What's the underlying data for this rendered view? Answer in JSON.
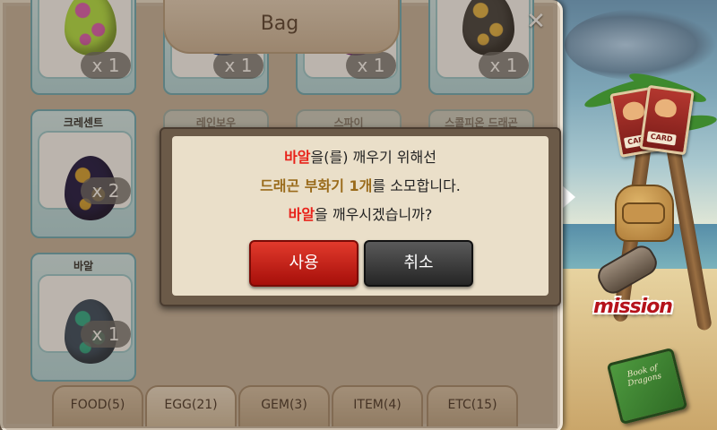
{
  "bag": {
    "title": "Bag",
    "close_label": "✕",
    "slots": [
      {
        "label": "",
        "count": "x 1",
        "egg_color": "#b6e84a",
        "spot_color": "#e062b8"
      },
      {
        "label": "",
        "count": "x 1",
        "egg_color": "#2257c6",
        "spot_color": "#6bb1ff"
      },
      {
        "label": "",
        "count": "x 1",
        "egg_color": "#a03ab8",
        "spot_color": "#e06fd9"
      },
      {
        "label": "",
        "count": "x 1",
        "egg_color": "#444444",
        "spot_color": "#e7b84a"
      },
      {
        "label": "크레센트",
        "count": "x 2",
        "egg_color": "#1e1a4a",
        "spot_color": "#d9a638"
      },
      {
        "label": "레인보우",
        "count": "",
        "egg_color": "#cccccc",
        "spot_color": "#aaaaaa"
      },
      {
        "label": "스파이",
        "count": "",
        "egg_color": "#cccccc",
        "spot_color": "#aaaaaa"
      },
      {
        "label": "스콜피온 드래곤",
        "count": "",
        "egg_color": "#cccccc",
        "spot_color": "#aaaaaa"
      },
      {
        "label": "바알",
        "count": "x 1",
        "egg_color": "#3a4f66",
        "spot_color": "#2fb08f"
      }
    ],
    "tabs": [
      {
        "label": "FOOD(5)",
        "active": false
      },
      {
        "label": "EGG(21)",
        "active": true
      },
      {
        "label": "GEM(3)",
        "active": false
      },
      {
        "label": "ITEM(4)",
        "active": false
      },
      {
        "label": "ETC(15)",
        "active": false
      }
    ]
  },
  "dialog": {
    "line1_name": "바알",
    "line1_rest": "을(를) 깨우기 위해선",
    "line2_item": "드래곤 부화기 1개",
    "line2_rest": "를 소모합니다.",
    "line3_name": "바알",
    "line3_rest": "을 깨우시겠습니까?",
    "use_label": "사용",
    "cancel_label": "취소"
  },
  "sidebar": {
    "card_label": "CARD",
    "mission_label": "mission",
    "book_label": "Book of Dragons"
  },
  "colors": {
    "accent_red": "#e8221a",
    "item_brown": "#9a6b1b"
  }
}
